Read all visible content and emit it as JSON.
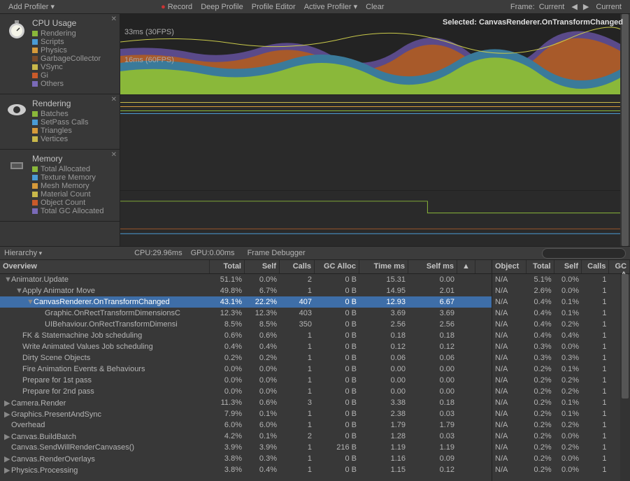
{
  "toolbar": {
    "add_profiler": "Add Profiler",
    "record": "Record",
    "deep_profile": "Deep Profile",
    "profile_editor": "Profile Editor",
    "active_profiler": "Active Profiler",
    "clear": "Clear",
    "frame_label": "Frame:",
    "frame_value": "Current",
    "current_btn": "Current"
  },
  "selected_label": "Selected: CanvasRenderer.OnTransformChanged",
  "modules": {
    "cpu": {
      "title": "CPU Usage",
      "items": [
        {
          "label": "Rendering",
          "color": "#8ab83a"
        },
        {
          "label": "Scripts",
          "color": "#4a9bd4"
        },
        {
          "label": "Physics",
          "color": "#d69a3a"
        },
        {
          "label": "GarbageCollector",
          "color": "#7a4a2a"
        },
        {
          "label": "VSync",
          "color": "#c9b84a"
        },
        {
          "label": "Gi",
          "color": "#c95a2a"
        },
        {
          "label": "Others",
          "color": "#7a6ab8"
        }
      ]
    },
    "rendering": {
      "title": "Rendering",
      "items": [
        {
          "label": "Batches",
          "color": "#8ab83a"
        },
        {
          "label": "SetPass Calls",
          "color": "#4a9bd4"
        },
        {
          "label": "Triangles",
          "color": "#d69a3a"
        },
        {
          "label": "Vertices",
          "color": "#c9b84a"
        }
      ]
    },
    "memory": {
      "title": "Memory",
      "items": [
        {
          "label": "Total Allocated",
          "color": "#8ab83a"
        },
        {
          "label": "Texture Memory",
          "color": "#4a9bd4"
        },
        {
          "label": "Mesh Memory",
          "color": "#d69a3a"
        },
        {
          "label": "Material Count",
          "color": "#c9b84a"
        },
        {
          "label": "Object Count",
          "color": "#c95a2a"
        },
        {
          "label": "Total GC Allocated",
          "color": "#7a6ab8"
        }
      ]
    }
  },
  "graph_ticks": {
    "t1": "33ms (30FPS)",
    "t2": "16ms (60FPS)"
  },
  "stats": {
    "hierarchy": "Hierarchy",
    "cpu": "CPU:29.96ms",
    "gpu": "GPU:0.00ms",
    "frame_dbg": "Frame Debugger",
    "search_ph": "",
    "search_icon": "🔍"
  },
  "columns_left": [
    "Overview",
    "Total",
    "Self",
    "Calls",
    "GC Alloc",
    "Time ms",
    "Self ms",
    ""
  ],
  "columns_right": [
    "Object",
    "Total",
    "Self",
    "Calls",
    "GC A"
  ],
  "rows_left": [
    {
      "indent": 0,
      "exp": "▼",
      "name": "Animator.Update",
      "total": "51.1%",
      "self": "0.0%",
      "calls": "2",
      "gc": "0 B",
      "time": "15.31",
      "sms": "0.00"
    },
    {
      "indent": 1,
      "exp": "▼",
      "name": "Apply Animator Move",
      "total": "49.8%",
      "self": "6.7%",
      "calls": "1",
      "gc": "0 B",
      "time": "14.95",
      "sms": "2.01"
    },
    {
      "indent": 2,
      "exp": "▼",
      "name": "CanvasRenderer.OnTransformChanged",
      "total": "43.1%",
      "self": "22.2%",
      "calls": "407",
      "gc": "0 B",
      "time": "12.93",
      "sms": "6.67",
      "sel": true
    },
    {
      "indent": 3,
      "exp": "",
      "name": "Graphic.OnRectTransformDimensionsC",
      "total": "12.3%",
      "self": "12.3%",
      "calls": "403",
      "gc": "0 B",
      "time": "3.69",
      "sms": "3.69"
    },
    {
      "indent": 3,
      "exp": "",
      "name": "UIBehaviour.OnRectTransformDimensi",
      "total": "8.5%",
      "self": "8.5%",
      "calls": "350",
      "gc": "0 B",
      "time": "2.56",
      "sms": "2.56"
    },
    {
      "indent": 1,
      "exp": "",
      "name": "FK & Statemachine Job scheduling",
      "total": "0.6%",
      "self": "0.6%",
      "calls": "1",
      "gc": "0 B",
      "time": "0.18",
      "sms": "0.18"
    },
    {
      "indent": 1,
      "exp": "",
      "name": "Write Animated Values Job scheduling",
      "total": "0.4%",
      "self": "0.4%",
      "calls": "1",
      "gc": "0 B",
      "time": "0.12",
      "sms": "0.12"
    },
    {
      "indent": 1,
      "exp": "",
      "name": "Dirty Scene Objects",
      "total": "0.2%",
      "self": "0.2%",
      "calls": "1",
      "gc": "0 B",
      "time": "0.06",
      "sms": "0.06"
    },
    {
      "indent": 1,
      "exp": "",
      "name": "Fire Animation Events & Behaviours",
      "total": "0.0%",
      "self": "0.0%",
      "calls": "1",
      "gc": "0 B",
      "time": "0.00",
      "sms": "0.00"
    },
    {
      "indent": 1,
      "exp": "",
      "name": "Prepare for 1st pass",
      "total": "0.0%",
      "self": "0.0%",
      "calls": "1",
      "gc": "0 B",
      "time": "0.00",
      "sms": "0.00"
    },
    {
      "indent": 1,
      "exp": "",
      "name": "Prepare for 2nd pass",
      "total": "0.0%",
      "self": "0.0%",
      "calls": "1",
      "gc": "0 B",
      "time": "0.00",
      "sms": "0.00"
    },
    {
      "indent": 0,
      "exp": "▶",
      "name": "Camera.Render",
      "total": "11.3%",
      "self": "0.6%",
      "calls": "3",
      "gc": "0 B",
      "time": "3.38",
      "sms": "0.18"
    },
    {
      "indent": 0,
      "exp": "▶",
      "name": "Graphics.PresentAndSync",
      "total": "7.9%",
      "self": "0.1%",
      "calls": "1",
      "gc": "0 B",
      "time": "2.38",
      "sms": "0.03"
    },
    {
      "indent": 0,
      "exp": "",
      "name": "Overhead",
      "total": "6.0%",
      "self": "6.0%",
      "calls": "1",
      "gc": "0 B",
      "time": "1.79",
      "sms": "1.79"
    },
    {
      "indent": 0,
      "exp": "▶",
      "name": "Canvas.BuildBatch",
      "total": "4.2%",
      "self": "0.1%",
      "calls": "2",
      "gc": "0 B",
      "time": "1.28",
      "sms": "0.03"
    },
    {
      "indent": 0,
      "exp": "",
      "name": "Canvas.SendWillRenderCanvases()",
      "total": "3.9%",
      "self": "3.9%",
      "calls": "1",
      "gc": "216 B",
      "time": "1.19",
      "sms": "1.19"
    },
    {
      "indent": 0,
      "exp": "▶",
      "name": "Canvas.RenderOverlays",
      "total": "3.8%",
      "self": "0.3%",
      "calls": "1",
      "gc": "0 B",
      "time": "1.16",
      "sms": "0.09"
    },
    {
      "indent": 0,
      "exp": "▶",
      "name": "Physics.Processing",
      "total": "3.8%",
      "self": "0.4%",
      "calls": "1",
      "gc": "0 B",
      "time": "1.15",
      "sms": "0.12"
    }
  ],
  "rows_right": [
    {
      "obj": "N/A",
      "total": "5.1%",
      "self": "0.0%",
      "calls": "1"
    },
    {
      "obj": "N/A",
      "total": "2.6%",
      "self": "0.0%",
      "calls": "1"
    },
    {
      "obj": "N/A",
      "total": "0.4%",
      "self": "0.1%",
      "calls": "1"
    },
    {
      "obj": "N/A",
      "total": "0.4%",
      "self": "0.1%",
      "calls": "1"
    },
    {
      "obj": "N/A",
      "total": "0.4%",
      "self": "0.2%",
      "calls": "1"
    },
    {
      "obj": "N/A",
      "total": "0.4%",
      "self": "0.4%",
      "calls": "1"
    },
    {
      "obj": "N/A",
      "total": "0.3%",
      "self": "0.0%",
      "calls": "1"
    },
    {
      "obj": "N/A",
      "total": "0.3%",
      "self": "0.3%",
      "calls": "1"
    },
    {
      "obj": "N/A",
      "total": "0.2%",
      "self": "0.1%",
      "calls": "1"
    },
    {
      "obj": "N/A",
      "total": "0.2%",
      "self": "0.2%",
      "calls": "1"
    },
    {
      "obj": "N/A",
      "total": "0.2%",
      "self": "0.2%",
      "calls": "1"
    },
    {
      "obj": "N/A",
      "total": "0.2%",
      "self": "0.1%",
      "calls": "1"
    },
    {
      "obj": "N/A",
      "total": "0.2%",
      "self": "0.1%",
      "calls": "1"
    },
    {
      "obj": "N/A",
      "total": "0.2%",
      "self": "0.2%",
      "calls": "1"
    },
    {
      "obj": "N/A",
      "total": "0.2%",
      "self": "0.0%",
      "calls": "1"
    },
    {
      "obj": "N/A",
      "total": "0.2%",
      "self": "0.2%",
      "calls": "1"
    },
    {
      "obj": "N/A",
      "total": "0.2%",
      "self": "0.0%",
      "calls": "1"
    },
    {
      "obj": "N/A",
      "total": "0.2%",
      "self": "0.0%",
      "calls": "1"
    }
  ]
}
